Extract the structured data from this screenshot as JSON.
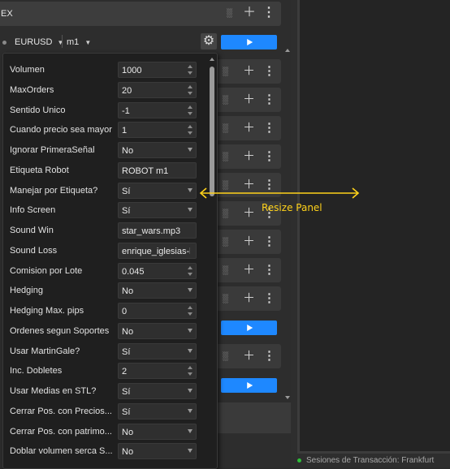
{
  "header": {
    "title": "EX",
    "icons": [
      "binoculars-icon",
      "plus-icon",
      "more-vertical-icon"
    ]
  },
  "symbol_bar": {
    "symbol": "EURUSD",
    "timeframe": "m1",
    "icons": [
      "settings-gear-icon",
      "play-icon"
    ]
  },
  "params": [
    {
      "label": "Volumen",
      "value": "1000",
      "control": "spin"
    },
    {
      "label": "MaxOrders",
      "value": "20",
      "control": "spin"
    },
    {
      "label": "Sentido Unico",
      "value": "-1",
      "control": "spin"
    },
    {
      "label": "Cuando precio sea mayor",
      "value": "1",
      "control": "spin"
    },
    {
      "label": "Ignorar PrimeraSeñal",
      "value": "No",
      "control": "select"
    },
    {
      "label": "Etiqueta Robot",
      "value": "ROBOT m1",
      "control": "text"
    },
    {
      "label": "Manejar por Etiqueta?",
      "value": "Sí",
      "control": "select"
    },
    {
      "label": "Info Screen",
      "value": "Sí",
      "control": "select"
    },
    {
      "label": "Sound Win",
      "value": "star_wars.mp3",
      "control": "text"
    },
    {
      "label": "Sound Loss",
      "value": "enrique_iglesias-ba",
      "control": "text"
    },
    {
      "label": "Comision por Lote",
      "value": "0.045",
      "control": "spin"
    },
    {
      "label": "Hedging",
      "value": "No",
      "control": "select"
    },
    {
      "label": "Hedging Max. pips",
      "value": "0",
      "control": "spin"
    },
    {
      "label": "Ordenes segun Soportes",
      "value": "No",
      "control": "select"
    },
    {
      "label": "Usar MartinGale?",
      "value": "Sí",
      "control": "select"
    },
    {
      "label": "Inc. Dobletes",
      "value": "2",
      "control": "spin"
    },
    {
      "label": "Usar Medias en STL?",
      "value": "Sí",
      "control": "select"
    },
    {
      "label": "Cerrar Pos. con Precios...",
      "value": "Sí",
      "control": "select"
    },
    {
      "label": "Cerrar Pos. con patrimo...",
      "value": "No",
      "control": "select"
    },
    {
      "label": "Doblar volumen serca S...",
      "value": "No",
      "control": "select"
    }
  ],
  "annotation": {
    "text": "Resize Panel",
    "color": "#ffd21a"
  },
  "status": {
    "text": "Sesiones de Transacción:  Frankfurt"
  },
  "colors": {
    "accent": "#1e88ff",
    "background": "#2b2b2b",
    "panel": "#1f1f1f"
  }
}
